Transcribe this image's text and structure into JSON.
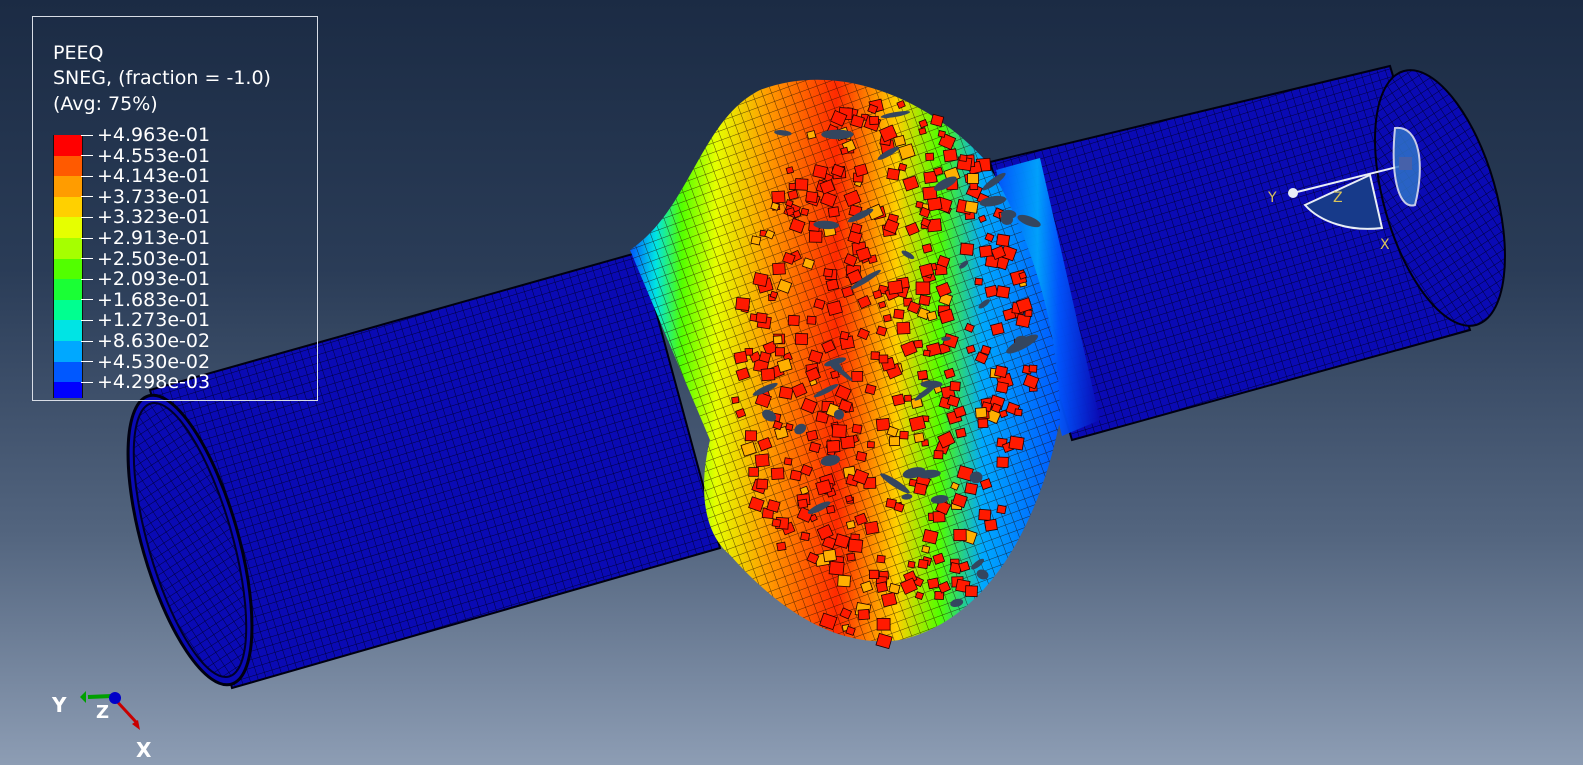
{
  "legend": {
    "title_lines": [
      "PEEQ",
      "SNEG, (fraction = -1.0)",
      "(Avg: 75%)"
    ],
    "values": [
      "+4.963e-01",
      "+4.553e-01",
      "+4.143e-01",
      "+3.733e-01",
      "+3.323e-01",
      "+2.913e-01",
      "+2.503e-01",
      "+2.093e-01",
      "+1.683e-01",
      "+1.273e-01",
      "+8.630e-02",
      "+4.530e-02",
      "+4.298e-03"
    ],
    "band_colors": [
      "#ff0000",
      "#ff5a00",
      "#ff9c00",
      "#ffd000",
      "#e6ff00",
      "#a6ff00",
      "#52ff00",
      "#1aff35",
      "#00ff90",
      "#00e4e4",
      "#00a8ff",
      "#0058ff",
      "#0000ff"
    ]
  },
  "view_triad": {
    "labels": {
      "x": "X",
      "y": "Y",
      "z": "Z"
    },
    "colors": {
      "x": "#c80000",
      "y": "#00a000",
      "z": "#0000c8"
    }
  },
  "orientation_glyph": {
    "labels": {
      "x": "X",
      "y": "Y",
      "z": "Z"
    }
  },
  "model": {
    "pipe_color": "#0a0ab4",
    "mesh_line_color": "#00003a"
  }
}
